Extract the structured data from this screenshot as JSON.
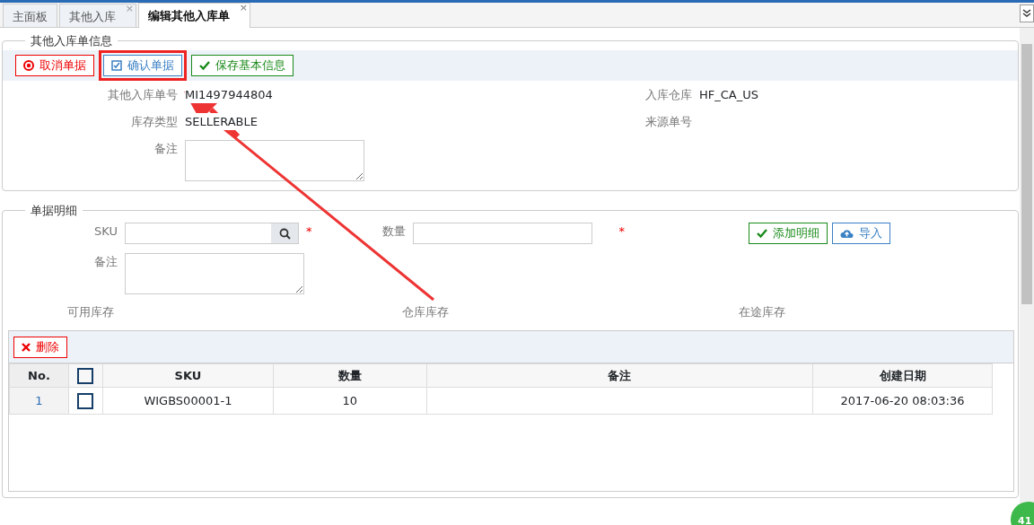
{
  "tabs": [
    {
      "label": "主面板",
      "selected": false
    },
    {
      "label": "其他入库",
      "selected": false,
      "close": "×"
    },
    {
      "label": "编辑其他入库单",
      "selected": true,
      "close": "×"
    }
  ],
  "info_section": {
    "legend": "其他入库单信息",
    "buttons": [
      {
        "kind": "cancel",
        "label": "取消单据",
        "highlighted": false
      },
      {
        "kind": "confirm",
        "label": "确认单据",
        "highlighted": true
      },
      {
        "kind": "save",
        "label": "保存基本信息",
        "highlighted": false
      }
    ],
    "fields": [
      {
        "label": "其他入库单号",
        "value": "MI1497944804"
      },
      {
        "label": "入库仓库",
        "value": "HF_CA_US"
      },
      {
        "label": "库存类型",
        "value": "SELLERABLE"
      },
      {
        "label": "来源单号"
      }
    ],
    "remark_label": "备注"
  },
  "detail_section": {
    "legend": "单据明细",
    "sku_label": "SKU",
    "sku_required": "*",
    "qty_label": "数量",
    "qty_required": "*",
    "remark_label": "备注",
    "add_button": "添加明细",
    "import_button": "导入",
    "stock_labels": [
      "可用库存",
      "仓库库存",
      "在途库存"
    ],
    "delete_button": "删除",
    "table": {
      "select_all_checked": false,
      "columns": [
        "No.",
        "SKU",
        "数量",
        "备注",
        "创建日期"
      ],
      "rows": [
        {
          "no": "1",
          "sku": "WIGBS00001-1",
          "qty": "10",
          "remark": "",
          "created": "2017-06-20 08:03:36",
          "checked": false
        }
      ]
    }
  },
  "badge": "41"
}
